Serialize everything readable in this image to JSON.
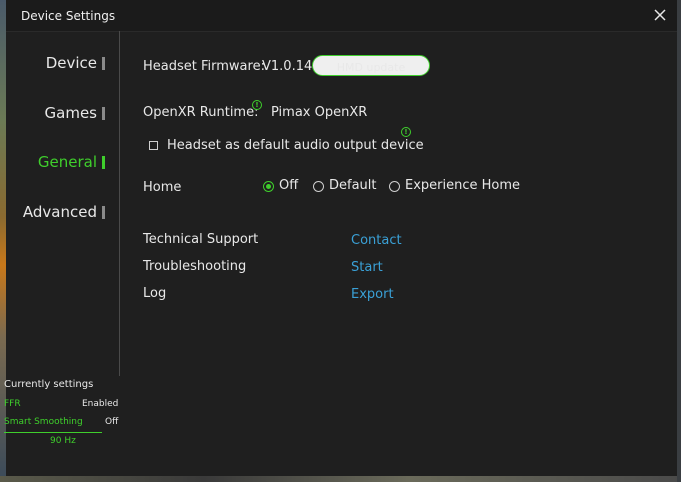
{
  "window": {
    "title": "Device Settings"
  },
  "sidebar": {
    "items": [
      {
        "label": "Device",
        "active": false
      },
      {
        "label": "Games",
        "active": false
      },
      {
        "label": "General",
        "active": true
      },
      {
        "label": "Advanced",
        "active": false
      }
    ]
  },
  "firmware": {
    "label": "Headset Firmware:",
    "version": "V1.0.14",
    "update_button": "HMD update"
  },
  "openxr": {
    "label": "OpenXR Runtime:",
    "value": "Pimax OpenXR"
  },
  "audio": {
    "label": "Headset as default audio output device",
    "checked": false
  },
  "home": {
    "label": "Home",
    "options": [
      {
        "label": "Off",
        "selected": true
      },
      {
        "label": "Default",
        "selected": false
      },
      {
        "label": "Experience Home",
        "selected": false
      }
    ]
  },
  "support": {
    "rows": [
      {
        "label": "Technical Support",
        "action": "Contact"
      },
      {
        "label": "Troubleshooting",
        "action": "Start"
      },
      {
        "label": "Log",
        "action": "Export"
      }
    ]
  },
  "status": {
    "title": "Currently settings",
    "ffr_label": "FFR",
    "ffr_value": "Enabled",
    "smoothing_label": "Smart Smoothing",
    "smoothing_value": "Off",
    "refresh": "90 Hz"
  },
  "colors": {
    "accent": "#3fcf2c",
    "link": "#3aa0d6",
    "background": "#1f1f1f"
  }
}
